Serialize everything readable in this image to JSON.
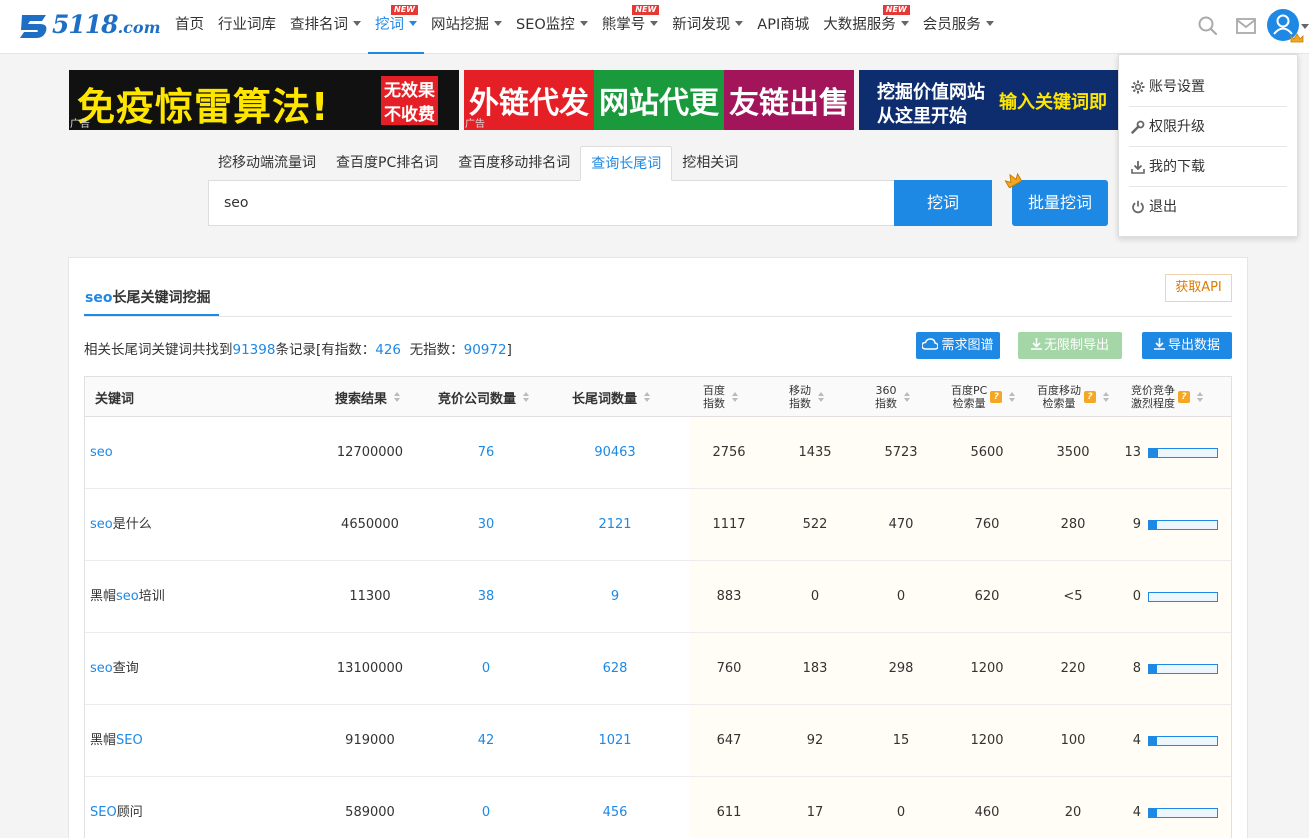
{
  "header": {
    "logo_text": "5118",
    "logo_suffix": ".com",
    "nav": [
      {
        "label": "首页",
        "caret": false,
        "new": false
      },
      {
        "label": "行业词库",
        "caret": false,
        "new": false
      },
      {
        "label": "查排名词",
        "caret": true,
        "new": false
      },
      {
        "label": "挖词",
        "caret": true,
        "new": true,
        "active": true
      },
      {
        "label": "网站挖掘",
        "caret": true,
        "new": false
      },
      {
        "label": "SEO监控",
        "caret": true,
        "new": false
      },
      {
        "label": "熊掌号",
        "caret": true,
        "new": true
      },
      {
        "label": "新词发现",
        "caret": true,
        "new": false
      },
      {
        "label": "API商城",
        "caret": false,
        "new": false
      },
      {
        "label": "大数据服务",
        "caret": true,
        "new": true
      },
      {
        "label": "会员服务",
        "caret": true,
        "new": false
      }
    ],
    "new_badge": "NEW",
    "icons": [
      "search-icon",
      "mail-icon",
      "user-avatar-icon"
    ]
  },
  "banners": [
    {
      "text1": "免疫惊雷算法!",
      "text2": "无效果",
      "text3": "不收费",
      "ad": "广告",
      "bg": "#111111"
    },
    {
      "text1": "外链代发",
      "ad": "广告",
      "bg": "#e41f26"
    },
    {
      "text1": "网站代更",
      "bg": "#1a9a3c"
    },
    {
      "text1": "友链出售",
      "bg": "#a3155a"
    },
    {
      "text1": "挖掘价值网站",
      "text2": "从这里开始",
      "text3": "输入关键词即",
      "bg": "#0d2d6e"
    }
  ],
  "search": {
    "tabs": [
      "挖移动端流量词",
      "查百度PC排名词",
      "查百度移动排名词",
      "查询长尾词",
      "挖相关词"
    ],
    "active_tab": 3,
    "value": "seo",
    "button": "挖词",
    "batch_button": "批量挖词"
  },
  "panel": {
    "title_kw": "seo",
    "title_rest": "长尾关键词挖掘",
    "api_button": "获取API",
    "summary": {
      "prefix": "相关长尾词关键词共找到",
      "total": "91398",
      "mid": "条记录[有指数：",
      "with_index": "426",
      "mid2": "  无指数：",
      "no_index": "90972",
      "suffix": "]"
    },
    "buttons": {
      "demand": "需求图谱",
      "unlimited": "无限制导出",
      "export": "导出数据"
    },
    "columns": {
      "keyword": "关键词",
      "results": "搜索结果",
      "bidders": "竞价公司数量",
      "longtail": "长尾词数量",
      "baidu_1": "百度",
      "baidu_2": "指数",
      "mobile_1": "移动",
      "mobile_2": "指数",
      "s360_1": "360",
      "s360_2": "指数",
      "pc_1": "百度PC",
      "pc_2": "检索量",
      "mob_1": "百度移动",
      "mob_2": "检索量",
      "comp_1": "竞价竞争",
      "comp_2": "激烈程度"
    },
    "rows": [
      {
        "kw_a": "",
        "kw_b": "seo",
        "kw_c": "",
        "results": "12700000",
        "bidders": "76",
        "longtail": "90463",
        "baidu": "2756",
        "mobile": "1435",
        "s360": "5723",
        "pc": "5600",
        "mob": "3500",
        "comp": "13",
        "comp_level": 0.13
      },
      {
        "kw_a": "",
        "kw_b": "seo",
        "kw_c": "是什么",
        "results": "4650000",
        "bidders": "30",
        "longtail": "2121",
        "baidu": "1117",
        "mobile": "522",
        "s360": "470",
        "pc": "760",
        "mob": "280",
        "comp": "9",
        "comp_level": 0.09
      },
      {
        "kw_a": "黑帽",
        "kw_b": "seo",
        "kw_c": "培训",
        "results": "11300",
        "bidders": "38",
        "longtail": "9",
        "baidu": "883",
        "mobile": "0",
        "s360": "0",
        "pc": "620",
        "mob": "<5",
        "comp": "0",
        "comp_level": 0
      },
      {
        "kw_a": "",
        "kw_b": "seo",
        "kw_c": "查询",
        "results": "13100000",
        "bidders": "0",
        "longtail": "628",
        "baidu": "760",
        "mobile": "183",
        "s360": "298",
        "pc": "1200",
        "mob": "220",
        "comp": "8",
        "comp_level": 0.08
      },
      {
        "kw_a": "黑帽",
        "kw_b": "SEO",
        "kw_c": "",
        "results": "919000",
        "bidders": "42",
        "longtail": "1021",
        "baidu": "647",
        "mobile": "92",
        "s360": "15",
        "pc": "1200",
        "mob": "100",
        "comp": "4",
        "comp_level": 0.04
      },
      {
        "kw_a": "",
        "kw_b": "SEO",
        "kw_c": "顾问",
        "results": "589000",
        "bidders": "0",
        "longtail": "456",
        "baidu": "611",
        "mobile": "17",
        "s360": "0",
        "pc": "460",
        "mob": "20",
        "comp": "4",
        "comp_level": 0.04
      }
    ]
  },
  "user_menu": [
    {
      "label": "账号设置",
      "icon": "gear-icon"
    },
    {
      "label": "权限升级",
      "icon": "wrench-icon"
    },
    {
      "label": "我的下载",
      "icon": "download-icon"
    },
    {
      "label": "退出",
      "icon": "power-icon"
    }
  ],
  "colors": {
    "accent": "#1e88e5",
    "light_green": "#a5d6a7",
    "orange": "#e07b00"
  }
}
